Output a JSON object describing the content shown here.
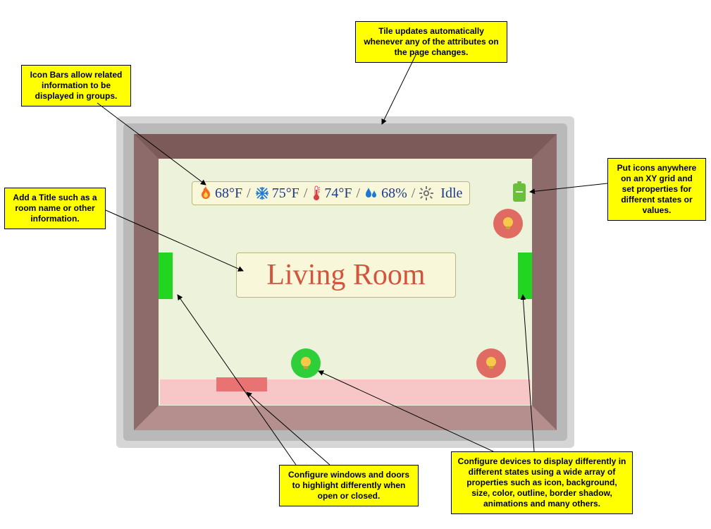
{
  "callouts": {
    "top": "Tile updates automatically whenever any of the attributes on the page changes.",
    "iconbars": "Icon Bars allow related information to be displayed in groups.",
    "title": "Add a Title such as a room name or other information.",
    "gridicons": "Put icons anywhere on an XY grid and set properties for different states or values.",
    "windows": "Configure windows and doors to highlight differently when open or closed.",
    "devices": "Configure devices to display differently in different states using a wide array of properties such as icon, background, size, color, outline, border shadow, animations and many others."
  },
  "iconbar": {
    "heat": "68°F",
    "cool": "75°F",
    "temp": "74°F",
    "humid": "68%",
    "status": "Idle",
    "sep": "/"
  },
  "room_title": "Living Room"
}
